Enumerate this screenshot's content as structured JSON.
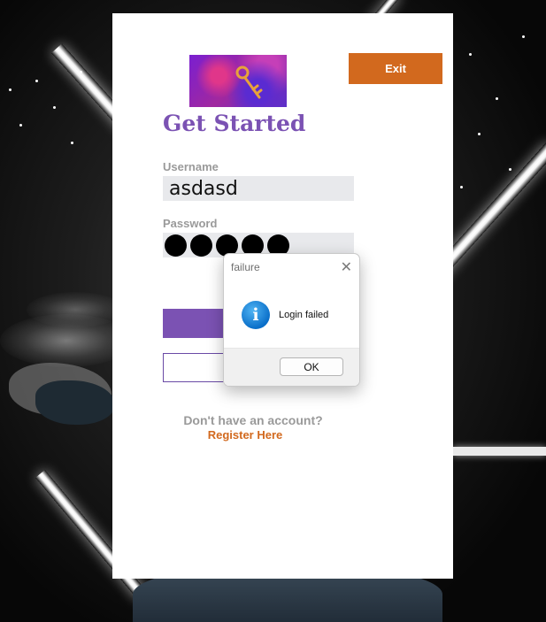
{
  "exit_button": {
    "label": "Exit"
  },
  "form": {
    "title": "Get Started",
    "username_label": "Username",
    "username_value": "asdasd",
    "password_label": "Password",
    "password_masked_count": 5,
    "no_account_text": "Don't have an account?",
    "register_link": "Register Here"
  },
  "dialog": {
    "title": "failure",
    "message": "Login failed",
    "ok_label": "OK",
    "icon": "info-icon",
    "close_icon": "close-icon"
  },
  "colors": {
    "accent_purple": "#7b52b3",
    "accent_orange": "#d2691e",
    "field_bg": "#e8e9ec",
    "info_blue": "#0a6fc9"
  }
}
